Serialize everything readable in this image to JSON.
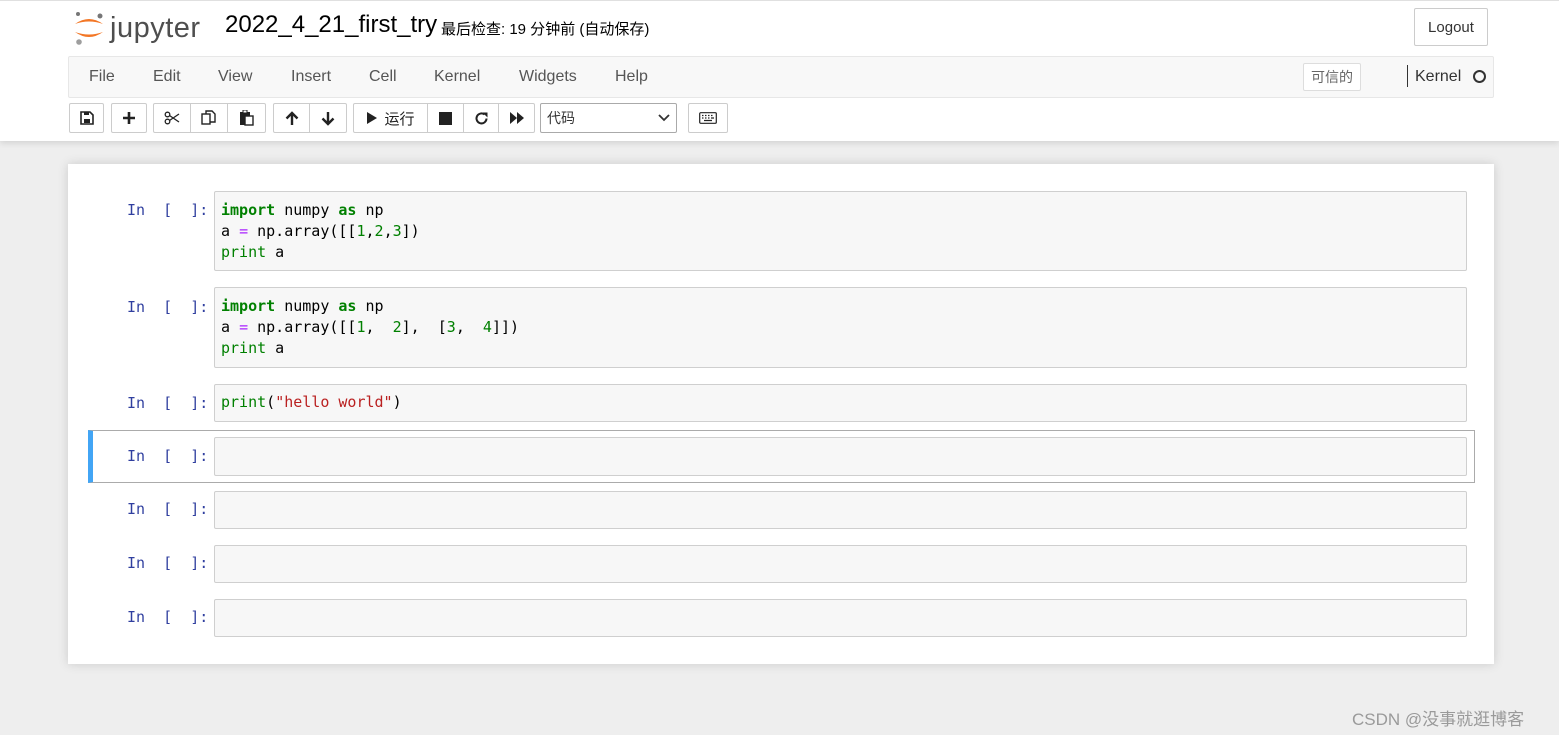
{
  "header": {
    "logo_text": "jupyter",
    "notebook_name": "2022_4_21_first_try",
    "save_status": "最后检查: 19 分钟前  (自动保存)",
    "logout_label": "Logout"
  },
  "menubar": {
    "items": [
      "File",
      "Edit",
      "View",
      "Insert",
      "Cell",
      "Kernel",
      "Widgets",
      "Help"
    ],
    "trusted_label": "可信的",
    "kernel_label": "Kernel"
  },
  "toolbar": {
    "run_label": "运行",
    "cell_type": "代码",
    "icons": [
      "save-icon",
      "plus-icon",
      "cut-icon",
      "copy-icon",
      "paste-icon",
      "arrow-up-icon",
      "arrow-down-icon",
      "play-icon",
      "stop-icon",
      "restart-icon",
      "fast-forward-icon",
      "keyboard-icon"
    ]
  },
  "cells": [
    {
      "prompt": "In  [  ]:",
      "lines": [
        [
          {
            "t": "import",
            "c": "kw"
          },
          {
            "t": " numpy "
          },
          {
            "t": "as",
            "c": "kw"
          },
          {
            "t": " np"
          }
        ],
        [
          {
            "t": "a "
          },
          {
            "t": "=",
            "c": "op"
          },
          {
            "t": " np.array([["
          },
          {
            "t": "1",
            "c": "num"
          },
          {
            "t": ","
          },
          {
            "t": "2",
            "c": "num"
          },
          {
            "t": ","
          },
          {
            "t": "3",
            "c": "num"
          },
          {
            "t": "])"
          }
        ],
        [
          {
            "t": "print",
            "c": "bi"
          },
          {
            "t": " a"
          }
        ]
      ]
    },
    {
      "prompt": "In  [  ]:",
      "lines": [
        [
          {
            "t": "import",
            "c": "kw"
          },
          {
            "t": " numpy "
          },
          {
            "t": "as",
            "c": "kw"
          },
          {
            "t": " np"
          }
        ],
        [
          {
            "t": "a "
          },
          {
            "t": "=",
            "c": "op"
          },
          {
            "t": " np.array([["
          },
          {
            "t": "1",
            "c": "num"
          },
          {
            "t": ",  "
          },
          {
            "t": "2",
            "c": "num"
          },
          {
            "t": "],  ["
          },
          {
            "t": "3",
            "c": "num"
          },
          {
            "t": ",  "
          },
          {
            "t": "4",
            "c": "num"
          },
          {
            "t": "]])"
          }
        ],
        [
          {
            "t": "print",
            "c": "bi"
          },
          {
            "t": " a"
          }
        ]
      ]
    },
    {
      "prompt": "In  [  ]:",
      "lines": [
        [
          {
            "t": "print",
            "c": "bi"
          },
          {
            "t": "("
          },
          {
            "t": "\"hello world\"",
            "c": "str"
          },
          {
            "t": ")"
          }
        ]
      ]
    },
    {
      "prompt": "In  [  ]:",
      "lines": []
    },
    {
      "prompt": "In  [  ]:",
      "lines": []
    },
    {
      "prompt": "In  [  ]:",
      "lines": []
    },
    {
      "prompt": "In  [  ]:",
      "lines": []
    }
  ],
  "watermark": "CSDN @没事就逛博客",
  "colors": {
    "selected_cell_accent": "#42a5f5",
    "prompt": "#303f9f",
    "keyword": "#008000",
    "string": "#ba2121",
    "operator": "#aa22ff"
  }
}
